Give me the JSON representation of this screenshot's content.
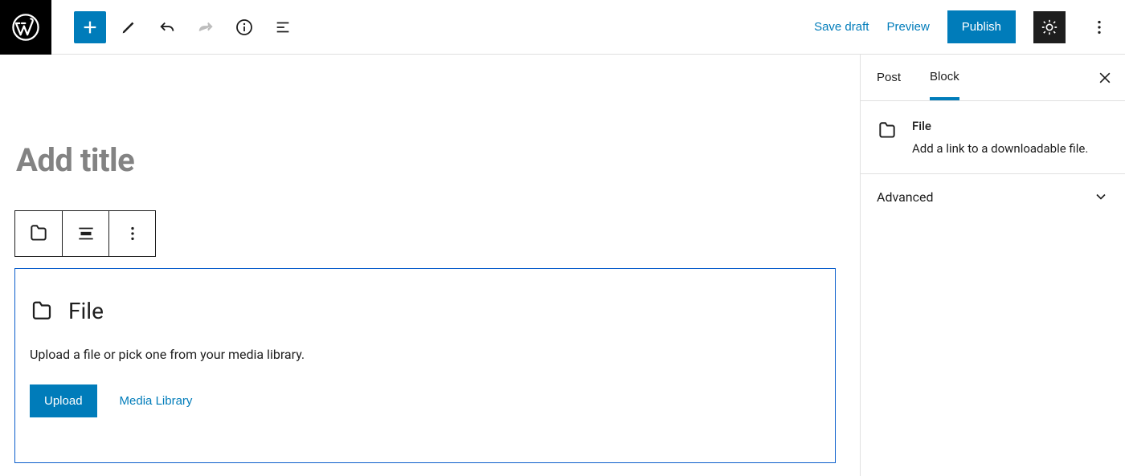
{
  "toolbar": {
    "save_draft": "Save draft",
    "preview": "Preview",
    "publish": "Publish"
  },
  "editor": {
    "title_placeholder": "Add title",
    "file_block": {
      "title": "File",
      "description": "Upload a file or pick one from your media library.",
      "upload_label": "Upload",
      "media_library_label": "Media Library"
    }
  },
  "sidebar": {
    "tabs": {
      "post": "Post",
      "block": "Block"
    },
    "block_info": {
      "name": "File",
      "description": "Add a link to a downloadable file."
    },
    "advanced_label": "Advanced"
  }
}
